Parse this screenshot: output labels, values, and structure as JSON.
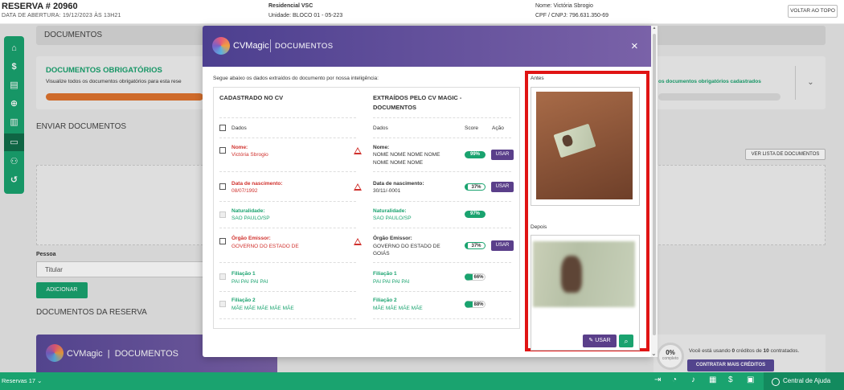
{
  "header": {
    "title": "RESERVA # 20960",
    "subtitle": "DATA DE ABERTURA: 19/12/2023 ÀS 13H21",
    "empreendimento": "Residencial VSC",
    "unidade": "Unidade: BLOCO 01 - 05-223",
    "nome": "Nome: Victória Sbrogio",
    "cpf": "CPF / CNPJ: 796.631.350-69",
    "back_top_label": "VOLTAR AO TOPO"
  },
  "sidenav": {
    "items": [
      {
        "icon": "home-icon",
        "glyph": "⌂"
      },
      {
        "icon": "dollar-icon",
        "glyph": "$"
      },
      {
        "icon": "document-money-icon",
        "glyph": "▤"
      },
      {
        "icon": "search-money-icon",
        "glyph": "⊕"
      },
      {
        "icon": "document-icon",
        "glyph": "▥"
      },
      {
        "icon": "folder-icon",
        "glyph": "▭"
      },
      {
        "icon": "users-icon",
        "glyph": "⚇"
      },
      {
        "icon": "history-icon",
        "glyph": "↺"
      }
    ]
  },
  "page": {
    "section_docs": "DOCUMENTOS",
    "required_title": "DOCUMENTOS OBRIGATÓRIOS",
    "required_sub": "Visualize todos os documentos obrigatórios para esta rese",
    "required_right": "os documentos obrigatórios cadastrados",
    "send_title": "ENVIAR DOCUMENTOS",
    "list_button": "VER LISTA DE DOCUMENTOS",
    "pessoa_label": "Pessoa",
    "pessoa_value": "Titular",
    "add_button": "ADICIONAR",
    "reserve_docs_title": "DOCUMENTOS DA RESERVA",
    "banner_brand": "CVMagic",
    "banner_title": "DOCUMENTOS",
    "credit_pct": "0%",
    "credit_lbl": "completo",
    "credit_text_pre": "Você está usando ",
    "credit_used": "0",
    "credit_text_mid": " créditos de ",
    "credit_total": "10",
    "credit_text_post": " contratados.",
    "contract_button": "CONTRATAR MAIS CRÉDITOS"
  },
  "modal": {
    "brand": "CVMagic",
    "title": "DOCUMENTOS",
    "close_glyph": "×",
    "intro": "Segue abaixo os dados extraídos do documento por nossa inteligência:",
    "col_left_title": "CADASTRADO NO CV",
    "col_right_title_1": "EXTRAÍDOS PELO CV MAGIC -",
    "col_right_title_2": "DOCUMENTOS",
    "left_header": "Dados",
    "right_header_dados": "Dados",
    "right_header_score": "Score",
    "right_header_acao": "Ação",
    "use_label": "USAR",
    "rows": [
      {
        "label": "Nome:",
        "left": "Victória Sbrogio",
        "state": "err",
        "right_label": "Nome:",
        "right_lines": [
          "NOME NOME NOME NOME",
          "NOME NOME NOME"
        ],
        "score": "99%",
        "score_type": "full",
        "action": true
      },
      {
        "label": "Data de nascimento:",
        "left": "08/07/1992",
        "state": "err",
        "right_label": "Data de nascimento:",
        "right_lines": [
          "30/11/-0001"
        ],
        "score": "37%",
        "score_type": "part",
        "action": true
      },
      {
        "label": "Naturalidade:",
        "left": "SAO PAULO/SP",
        "state": "ok",
        "right_label": "Naturalidade:",
        "right_lines": [
          "SAO PAULO/SP"
        ],
        "score": "97%",
        "score_type": "full",
        "action": false
      },
      {
        "label": "Órgão Emissor:",
        "left": "GOVERNO DO ESTADO DE",
        "state": "err",
        "right_label": "Órgão Emissor:",
        "right_lines": [
          "GOVERNO DO ESTADO DE",
          "GOIÁS"
        ],
        "score": "37%",
        "score_type": "part",
        "action": true
      },
      {
        "label": "Filiação 1",
        "left": "PAI PAI PAI PAI",
        "state": "ok",
        "right_label": "Filiação 1",
        "right_lines": [
          "PAI PAI PAI PAI"
        ],
        "score": "66%",
        "score_type": "gray",
        "action": false
      },
      {
        "label": "Filiação 2",
        "left": "MÃE MÃE MÃE MÃE MÃE",
        "state": "ok",
        "right_label": "Filiação 2",
        "right_lines": [
          "MÃE MÃE MÃE MÃE"
        ],
        "score": "88%",
        "score_type": "gray",
        "action": false
      }
    ],
    "antes_label": "Antes",
    "depois_label": "Depois",
    "use_image_label": "USAR"
  },
  "bottombar": {
    "left": "Reservas  17  ⌄",
    "help": "Central de Ajuda",
    "icons": [
      "logout-icon",
      "notification-icon",
      "bell-icon",
      "calendar-icon",
      "dollar-icon",
      "calculator-icon"
    ]
  },
  "colors": {
    "primary_green": "#1aa36f",
    "purple": "#5a3f8a",
    "error_red": "#d0312d",
    "highlight_border": "#e01414"
  }
}
